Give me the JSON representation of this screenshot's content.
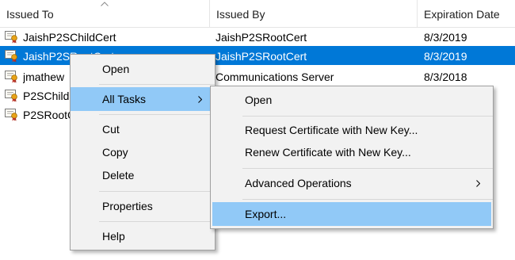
{
  "columns": {
    "issued_to": "Issued To",
    "issued_by": "Issued By",
    "expiration_date": "Expiration Date"
  },
  "rows": [
    {
      "issued_to": "JaishP2SChildCert",
      "issued_by": "JaishP2SRootCert",
      "expiration": "8/3/2019",
      "selected": false
    },
    {
      "issued_to": "JaishP2SRootCert",
      "issued_by": "JaishP2SRootCert",
      "expiration": "8/3/2019",
      "selected": true
    },
    {
      "issued_to": "jmathew",
      "issued_by": "Communications Server",
      "expiration": "8/3/2018",
      "selected": false
    },
    {
      "issued_to": "P2SChildCert",
      "issued_by": "",
      "expiration": "",
      "selected": false
    },
    {
      "issued_to": "P2SRootCert",
      "issued_by": "",
      "expiration": "",
      "selected": false
    }
  ],
  "context_menu": {
    "open": "Open",
    "all_tasks": "All Tasks",
    "cut": "Cut",
    "copy": "Copy",
    "delete": "Delete",
    "properties": "Properties",
    "help": "Help"
  },
  "submenu": {
    "open": "Open",
    "request_new_key": "Request Certificate with New Key...",
    "renew_new_key": "Renew Certificate with New Key...",
    "advanced_operations": "Advanced Operations",
    "export": "Export..."
  },
  "colors": {
    "selection": "#0078d7",
    "menu_highlight": "#91c9f7",
    "menu_background": "#f2f2f2"
  },
  "icons": {
    "row_icon": "certificate-icon",
    "sort": "sort-ascending-icon",
    "submenu": "chevron-right-icon"
  }
}
